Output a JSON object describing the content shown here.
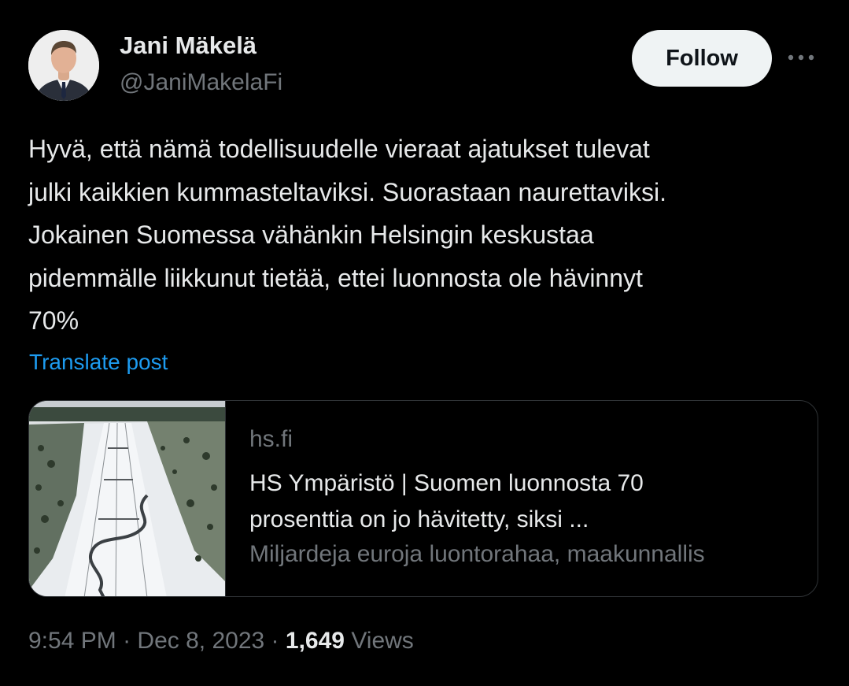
{
  "author": {
    "display_name": "Jani Mäkelä",
    "handle": "@JaniMakelaFi",
    "avatar_icon": "person-avatar-icon"
  },
  "actions": {
    "follow_label": "Follow",
    "more_icon": "more-horizontal-icon"
  },
  "post": {
    "text": "Hyvä, että nämä todellisuudelle vieraat ajatukset tulevat\njulki kaikkien kummasteltaviksi. Suorastaan naurettaviksi.\nJokainen Suomessa vähänkin Helsingin keskustaa\npidemmälle liikkunut tietää, ettei luonnosta ole hävinnyt\n70%",
    "translate_label": "Translate post"
  },
  "link_card": {
    "domain": "hs.fi",
    "title_line1": "HS Ympäristö | Suomen luonnosta 70",
    "title_line2": "prosenttia on jo hävitetty, siksi ...",
    "description": "Miljardeja euroja luontorahaa, maakunnallis"
  },
  "meta": {
    "time": "9:54 PM",
    "separator": "·",
    "date": "Dec 8, 2023",
    "views_count": "1,649",
    "views_label": "Views"
  },
  "colors": {
    "background": "#000000",
    "primary_text": "#e7e9ea",
    "secondary_text": "#71767b",
    "link": "#1d9bf0",
    "border": "#2f3336",
    "follow_bg": "#eff3f4"
  }
}
